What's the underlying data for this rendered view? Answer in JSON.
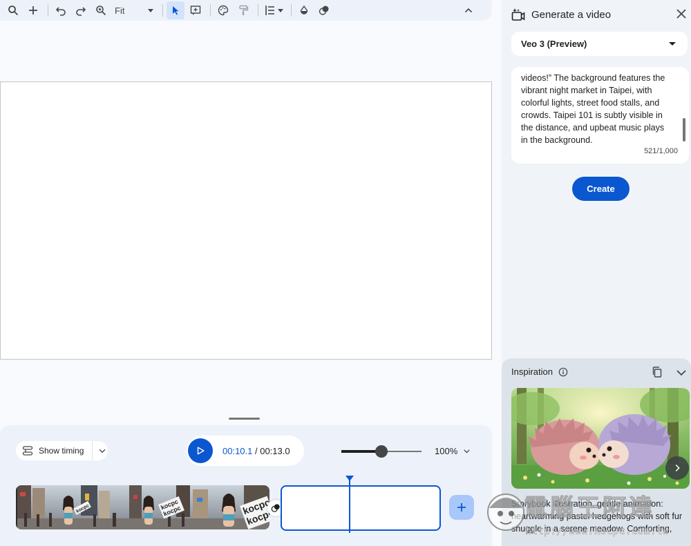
{
  "toolbar": {
    "zoom_fit_label": "Fit"
  },
  "timeline": {
    "show_timing_label": "Show timing",
    "current_time": "00:10.1",
    "separator": " / ",
    "total_time": "00:13.0",
    "zoom_percent_label": "100%",
    "zoom_level": 0.5
  },
  "panel": {
    "title": "Generate a video",
    "model": "Veo 3 (Preview)",
    "prompt_text": "videos!” The background features the\nvibrant night market in Taipei, with\ncolorful lights, street food stalls, and\ncrowds. Taipei 101 is subtly visible in\nthe distance, and upbeat music plays\nin the background.",
    "char_count": "521/1,000",
    "create_label": "Create"
  },
  "inspiration": {
    "title": "Inspiration",
    "text": "Storybook illustration, gentle animation:\nheartwarming pastel hedgehogs with soft fur\nsnuggle in a serene meadow. Comforting,"
  },
  "clip_sign": {
    "text": "kocpc"
  },
  "watermark": {
    "brand": "電腦王阿達",
    "url": "http://www.kocpc.com.tw"
  },
  "colors": {
    "accent": "#0b57d0",
    "panel_bg": "#f0f4f9"
  }
}
